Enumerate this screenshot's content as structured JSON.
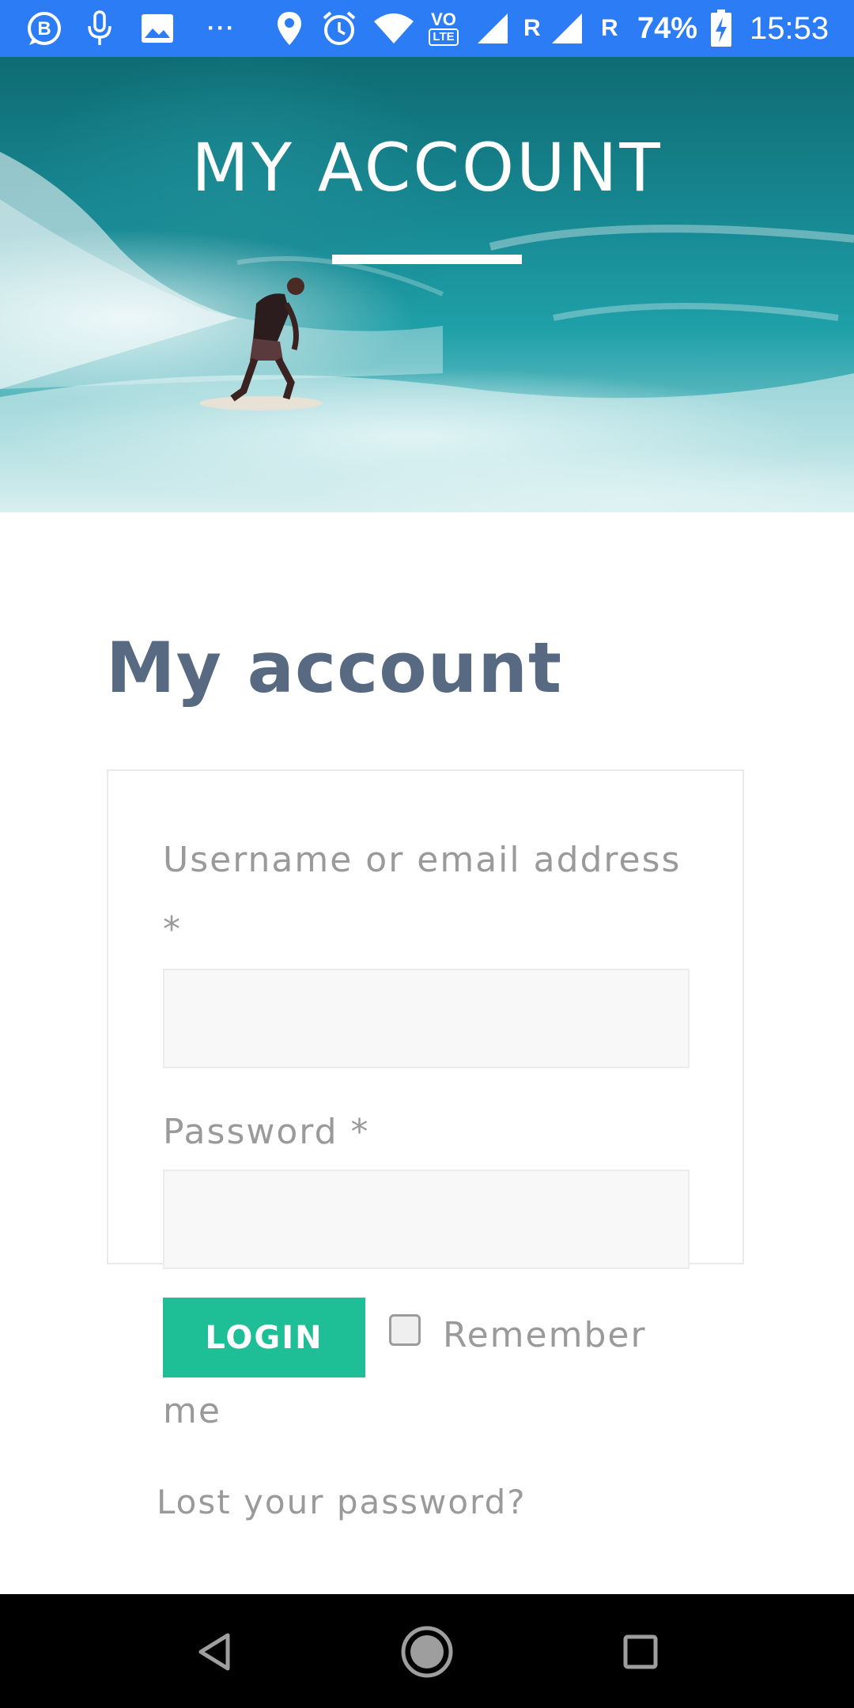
{
  "status_bar": {
    "battery": "74%",
    "time": "15:53",
    "network_r1": "R",
    "network_r2": "R",
    "volte": "VO",
    "lte": "LTE",
    "more": "···",
    "icons": [
      "b-circle-icon",
      "microphone-icon",
      "image-icon",
      "more-icon",
      "location-icon",
      "alarm-icon",
      "wifi-icon",
      "volte-icon",
      "signal-icon",
      "signal-icon",
      "battery-charging-icon"
    ]
  },
  "hero": {
    "title": "MY ACCOUNT"
  },
  "main": {
    "title": "My account"
  },
  "login_form": {
    "username_label": "Username or email address",
    "password_label": "Password",
    "required_mark": "*",
    "username_value": "",
    "password_value": "",
    "login_button": "LOGIN",
    "remember_label": "Remember me",
    "remember_checked": false,
    "lost_password": "Lost your password?"
  },
  "nav_bar": {
    "icons": [
      "back-icon",
      "home-icon",
      "recents-icon"
    ]
  },
  "colors": {
    "status_bar": "#2b7cf5",
    "title": "#586a82",
    "button": "#1ebe96",
    "label": "#9a9a9a"
  }
}
